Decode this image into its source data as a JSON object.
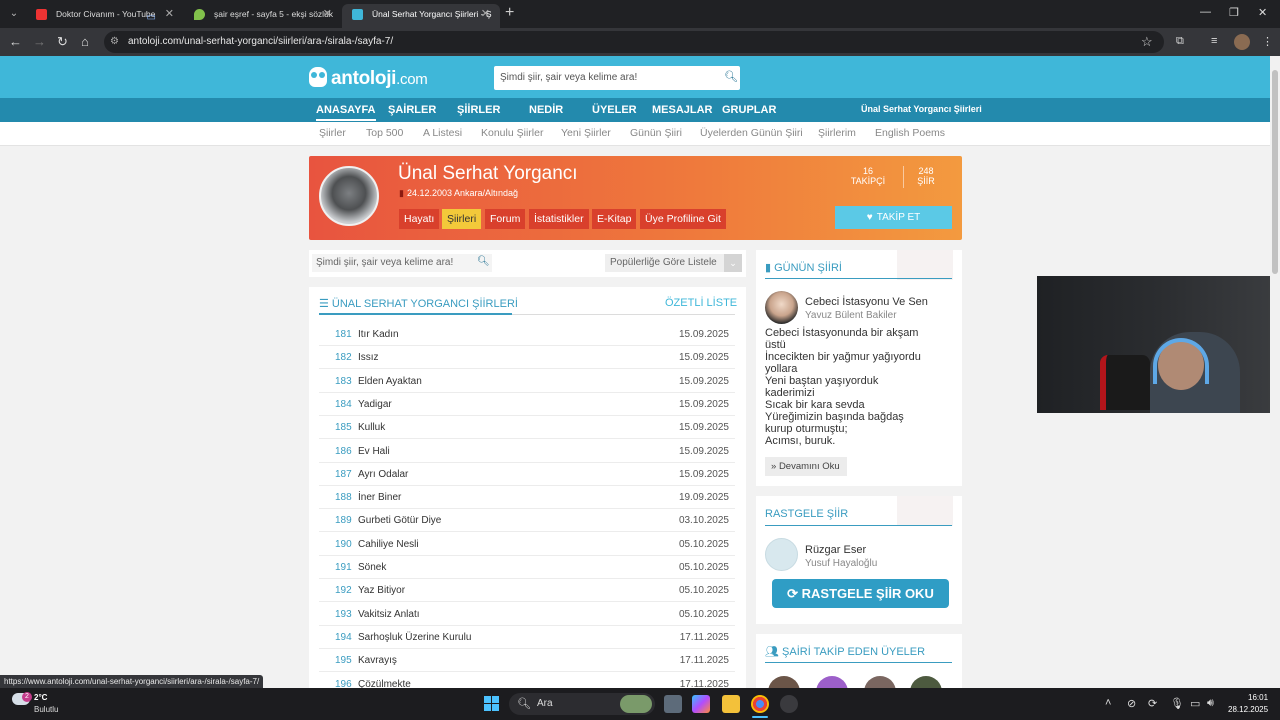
{
  "browser": {
    "tabs": [
      {
        "label": "Doktor Civanım - YouTube"
      },
      {
        "label": "şair eşref - sayfa 5 - ekşi sözlük"
      },
      {
        "label": "Ünal Serhat Yorgancı Şiirleri - Ş"
      }
    ],
    "url": "antoloji.com/unal-serhat-yorganci/siirleri/ara-/sirala-/sayfa-7/",
    "status_url": "https://www.antoloji.com/unal-serhat-yorganci/siirleri/ara-/sirala-/sayfa-7/"
  },
  "site": {
    "logo_main": "antoloji",
    "logo_tld": ".com",
    "search_placeholder": "Şimdi şiir, şair veya kelime ara!",
    "nav": [
      "ANASAYFA",
      "ŞAİRLER",
      "ŞİİRLER",
      "NEDİR",
      "ÜYELER",
      "MESAJLAR",
      "GRUPLAR"
    ],
    "nav_right": "Ünal Serhat Yorgancı Şiirleri",
    "sub_nav": [
      "Şiirler",
      "Top 500",
      "A Listesi",
      "Konulu Şiirler",
      "Yeni Şiirler",
      "Günün Şiiri",
      "Üyelerden Günün Şiiri",
      "Şiirlerim",
      "English Poems"
    ]
  },
  "profile": {
    "name": "Ünal Serhat Yorgancı",
    "birth": "24.12.2003 Ankara/Altındağ",
    "tabs": [
      "Hayatı",
      "Şiirleri",
      "Forum",
      "İstatistikler",
      "E-Kitap",
      "Üye Profiline Git"
    ],
    "followers_count": "16",
    "followers_label": "TAKİPÇİ",
    "poems_count": "248",
    "poems_label": "ŞİİR",
    "follow_label": "TAKİP ET"
  },
  "list": {
    "search_placeholder": "Şimdi şiir, şair veya kelime ara!",
    "sort_label": "Popülerliğe Göre Listele",
    "title": "ÜNAL SERHAT YORGANCI ŞİİRLERİ",
    "summary_link": "ÖZETLİ LİSTE",
    "poems": [
      {
        "num": "181",
        "title": "Itır Kadın",
        "date": "15.09.2025"
      },
      {
        "num": "182",
        "title": "Issız",
        "date": "15.09.2025"
      },
      {
        "num": "183",
        "title": "Elden Ayaktan",
        "date": "15.09.2025"
      },
      {
        "num": "184",
        "title": "Yadigar",
        "date": "15.09.2025"
      },
      {
        "num": "185",
        "title": "Kulluk",
        "date": "15.09.2025"
      },
      {
        "num": "186",
        "title": "Ev Hali",
        "date": "15.09.2025"
      },
      {
        "num": "187",
        "title": "Ayrı Odalar",
        "date": "15.09.2025"
      },
      {
        "num": "188",
        "title": "İner Biner",
        "date": "19.09.2025"
      },
      {
        "num": "189",
        "title": "Gurbeti Götür Diye",
        "date": "03.10.2025"
      },
      {
        "num": "190",
        "title": "Cahiliye Nesli",
        "date": "05.10.2025"
      },
      {
        "num": "191",
        "title": "Sönek",
        "date": "05.10.2025"
      },
      {
        "num": "192",
        "title": "Yaz Bitiyor",
        "date": "05.10.2025"
      },
      {
        "num": "193",
        "title": "Vakitsiz Anlatı",
        "date": "05.10.2025"
      },
      {
        "num": "194",
        "title": "Sarhoşluk Üzerine Kurulu",
        "date": "17.11.2025"
      },
      {
        "num": "195",
        "title": "Kavrayış",
        "date": "17.11.2025"
      },
      {
        "num": "196",
        "title": "Çözülmekte",
        "date": "17.11.2025"
      }
    ]
  },
  "gunun_siiri": {
    "heading": "GÜNÜN ŞİİRİ",
    "title": "Cebeci İstasyonu Ve Sen",
    "author": "Yavuz Bülent Bakiler",
    "lines": [
      "Cebeci İstasyonunda bir akşam",
      "üstü",
      "İncecikten bir yağmur yağıyordu",
      "yollara",
      "Yeni baştan yaşıyorduk",
      "kaderimizi",
      "Sıcak bir kara sevda",
      "Yüreğimizin başında bağdaş",
      "kurup oturmuştu;",
      "Acımsı, buruk."
    ],
    "more_label": "Devamını Oku"
  },
  "rastgele": {
    "heading": "RASTGELE ŞİİR",
    "title": "Rüzgar Eser",
    "author": "Yusuf Hayaloğlu",
    "button_label": "RASTGELE ŞİİR OKU"
  },
  "followers_card": {
    "heading": "ŞAİRİ TAKİP EDEN ÜYELER"
  },
  "taskbar": {
    "temp": "2°C",
    "weather": "Bulutlu",
    "weather_badge": "2",
    "search_label": "Ara",
    "time": "16:01",
    "date": "28.12.2025"
  },
  "colors": {
    "site_blue": "#3fb7d9",
    "nav_blue": "#238aad",
    "accent_orange": "#ef7a3c",
    "tab_active_yellow": "#f3c93a"
  }
}
